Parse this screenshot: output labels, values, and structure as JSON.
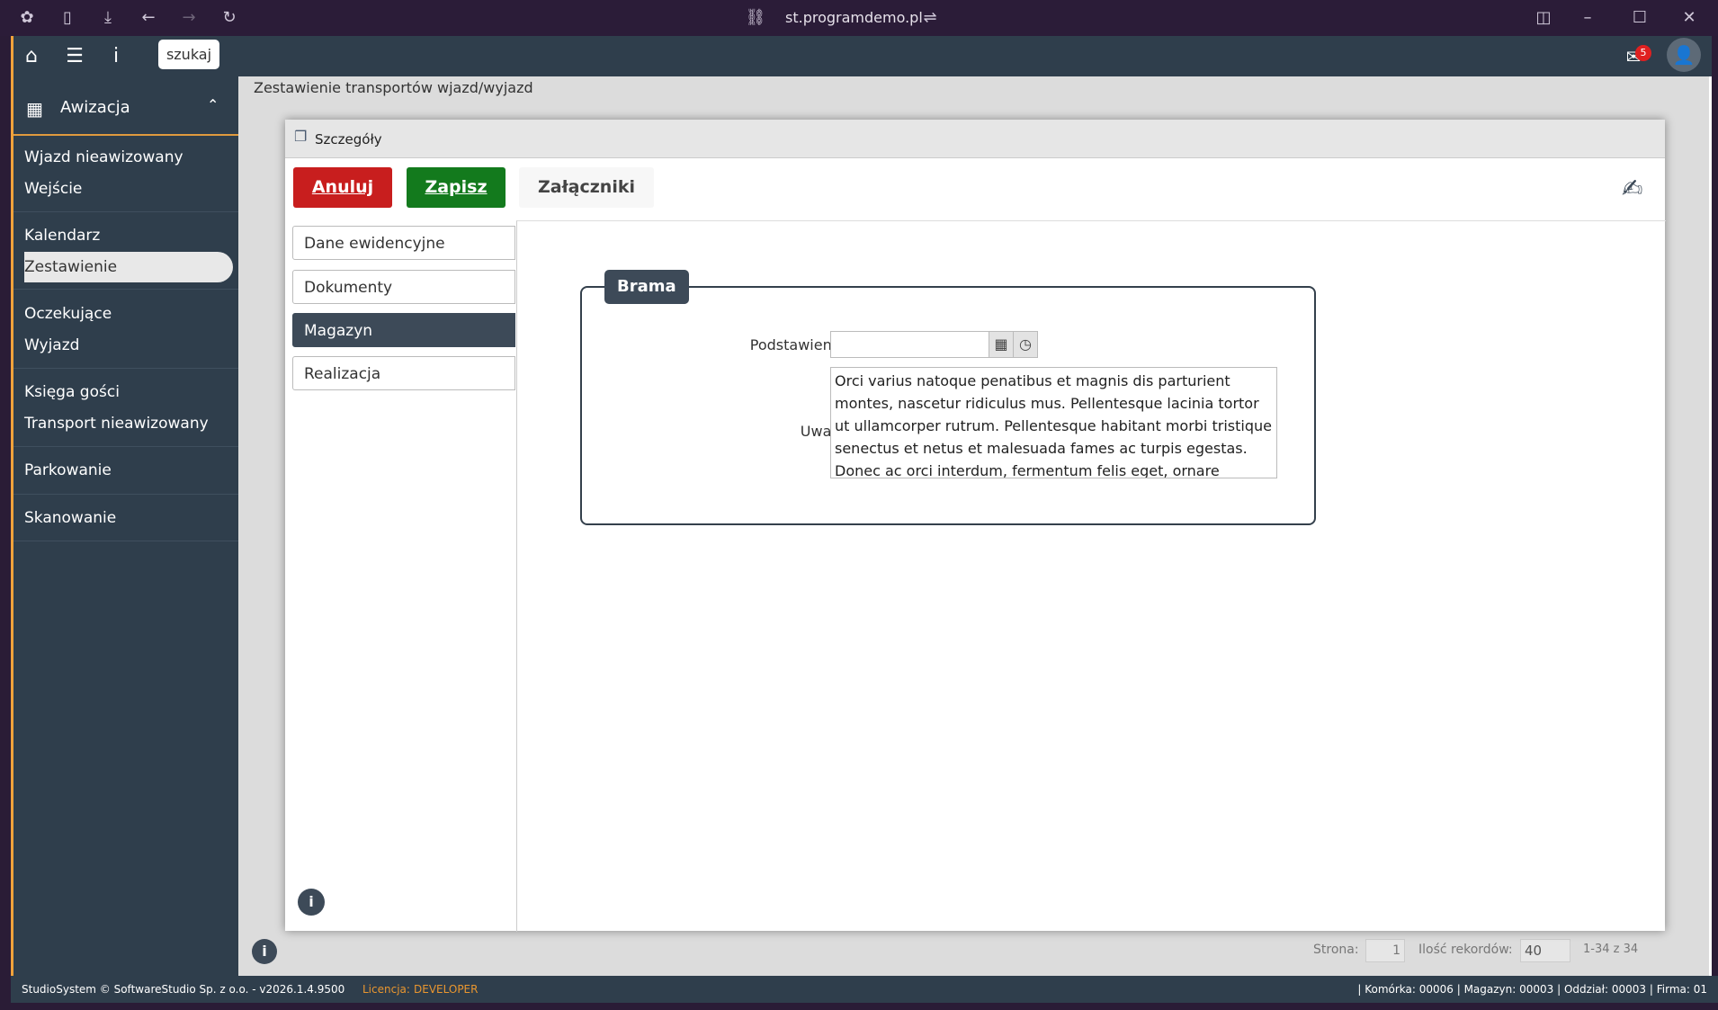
{
  "browser": {
    "url": "st.programdemo.pl"
  },
  "app": {
    "search_label": "szukaj",
    "mail_count": "5",
    "main_title": "Zestawienie transportów wjazd/wyjazd"
  },
  "sidebar": {
    "section_title": "Awizacja",
    "items": [
      {
        "label": "Wjazd nieawizowany"
      },
      {
        "label": "Wejście"
      },
      {
        "label": "Kalendarz"
      },
      {
        "label": "Zestawienie"
      },
      {
        "label": "Oczekujące"
      },
      {
        "label": "Wyjazd"
      },
      {
        "label": "Księga gości"
      },
      {
        "label": "Transport nieawizowany"
      },
      {
        "label": "Parkowanie"
      },
      {
        "label": "Skanowanie"
      }
    ]
  },
  "modal": {
    "title": "Szczegóły",
    "cancel_label": "Anuluj",
    "save_label": "Zapisz",
    "attachments_label": "Załączniki",
    "tabs": [
      {
        "label": "Dane ewidencyjne"
      },
      {
        "label": "Dokumenty"
      },
      {
        "label": "Magazyn"
      },
      {
        "label": "Realizacja"
      }
    ],
    "fieldset_title": "Brama",
    "field_podstawienie_label": "Podstawienie",
    "field_podstawienie_value": "",
    "field_uwagi_label": "Uwagi",
    "field_uwagi_value": "Orci varius natoque penatibus et magnis dis parturient montes, nascetur ridiculus mus. Pellentesque lacinia tortor ut ullamcorper rutrum. Pellentesque habitant morbi tristique senectus et netus et malesuada fames ac turpis egestas. Donec ac orci interdum, fermentum felis eget, ornare neque."
  },
  "pager": {
    "page_label": "Strona:",
    "page_value": "1",
    "records_label": "Ilość rekordów:",
    "records_value": "40",
    "range_text": "1-34 z 34"
  },
  "statusbar": {
    "copyright": "StudioSystem © SoftwareStudio Sp. z o.o. - v2026.1.4.9500",
    "license_label": "Licencja:",
    "license_value": "DEVELOPER",
    "right_info": "| Komórka: 00006 | Magazyn: 00003 | Oddział: 00003 | Firma: 01"
  },
  "colors": {
    "cancel": "#c81e1e",
    "save": "#137a1d",
    "sidebar": "#2f3e4c",
    "accent": "#f0a23b"
  }
}
